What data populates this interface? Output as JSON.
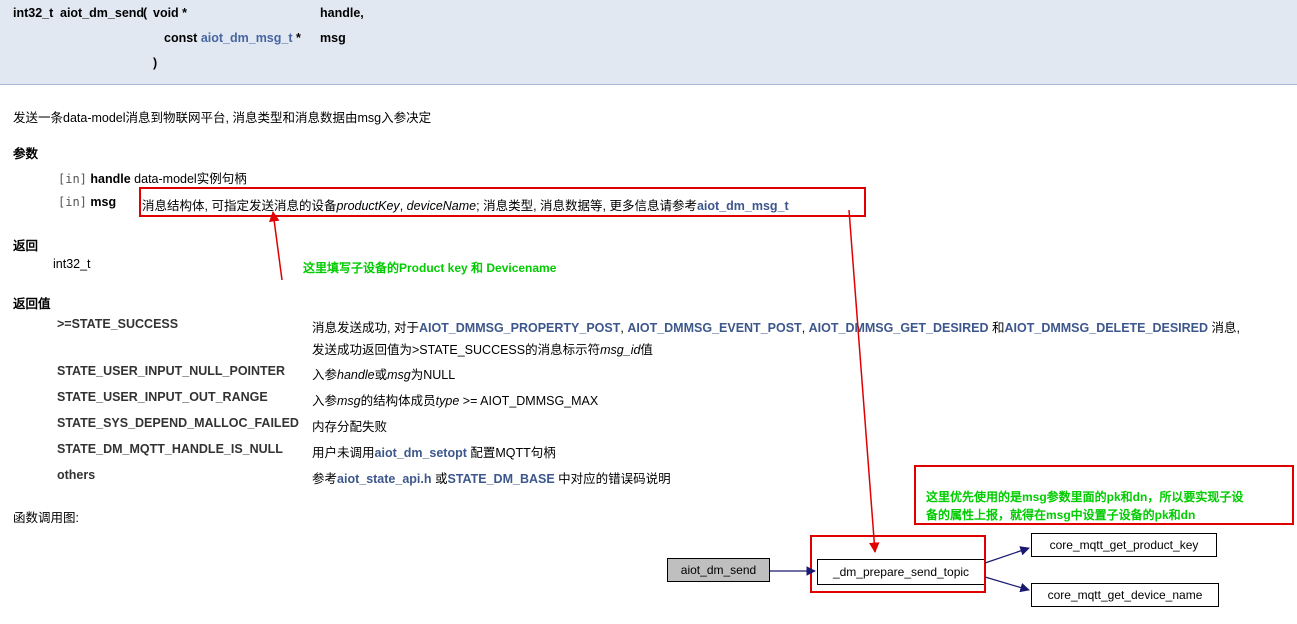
{
  "prototype": {
    "return_type": "int32_t",
    "func_name": "aiot_dm_send",
    "open_paren": "(",
    "param1_type": "void *",
    "param1_name": "handle,",
    "param2_type_prefix": "const ",
    "param2_type_link": "aiot_dm_msg_t",
    "param2_type_suffix": " *",
    "param2_name": "msg",
    "close_paren": ")"
  },
  "description": "发送一条data-model消息到物联网平台, 消息类型和消息数据由msg入参决定",
  "params_section": {
    "heading": "参数",
    "items": [
      {
        "dir": "[in]",
        "name": "handle",
        "desc": "data-model实例句柄"
      },
      {
        "dir": "[in]",
        "name": "msg",
        "desc_a": "消息结构体, 可指定发送消息的设备",
        "desc_em1": "productKey",
        "desc_b": ", ",
        "desc_em2": "deviceName",
        "desc_c": "; 消息类型, 消息数据等, 更多信息请参考",
        "desc_link": "aiot_dm_msg_t"
      }
    ]
  },
  "returns_section": {
    "heading": "返回",
    "value": "int32_t"
  },
  "retvals_section": {
    "heading": "返回值",
    "rows": [
      {
        "name": ">=STATE_SUCCESS",
        "p1": "消息发送成功, 对于",
        "l1": "AIOT_DMMSG_PROPERTY_POST",
        "p2": ", ",
        "l2": "AIOT_DMMSG_EVENT_POST",
        "p3": ", ",
        "l3": "AIOT_DMMSG_GET_DESIRED",
        "p4": " 和",
        "l4": "AIOT_DMMSG_DELETE_DESIRED",
        "p5": " 消息,",
        "line2_a": "发送成功返回值为>STATE_SUCCESS的消息标示符",
        "line2_em": "msg_id",
        "line2_b": "值"
      },
      {
        "name": "STATE_USER_INPUT_NULL_POINTER",
        "d_a": "入参",
        "d_em1": "handle",
        "d_b": "或",
        "d_em2": "msg",
        "d_c": "为NULL"
      },
      {
        "name": "STATE_USER_INPUT_OUT_RANGE",
        "d_a": "入参",
        "d_em1": "msg",
        "d_b": "的结构体成员",
        "d_em2": "type",
        "d_c": " >= AIOT_DMMSG_MAX"
      },
      {
        "name": "STATE_SYS_DEPEND_MALLOC_FAILED",
        "d": "内存分配失败"
      },
      {
        "name": "STATE_DM_MQTT_HANDLE_IS_NULL",
        "d_a": "用户未调用",
        "d_link": "aiot_dm_setopt",
        "d_b": " 配置MQTT句柄"
      },
      {
        "name": "others",
        "d_a": "参考",
        "d_link1": "aiot_state_api.h",
        "d_b": " 或",
        "d_link2": "STATE_DM_BASE",
        "d_c": " 中对应的错误码说明"
      }
    ]
  },
  "call_graph": {
    "label": "函数调用图:",
    "nodes": [
      "aiot_dm_send",
      "_dm_prepare_send_topic",
      "core_mqtt_get_product_key",
      "core_mqtt_get_device_name"
    ]
  },
  "annotations": {
    "note1": "这里填写子设备的Product key 和 Devicename",
    "note2_line1": "这里优先使用的是msg参数里面的pk和dn，所以要实现子设",
    "note2_line2": "备的属性上报，就得在msg中设置子设备的pk和dn",
    "box_color": "#e00000",
    "text_color": "#00cc00"
  }
}
